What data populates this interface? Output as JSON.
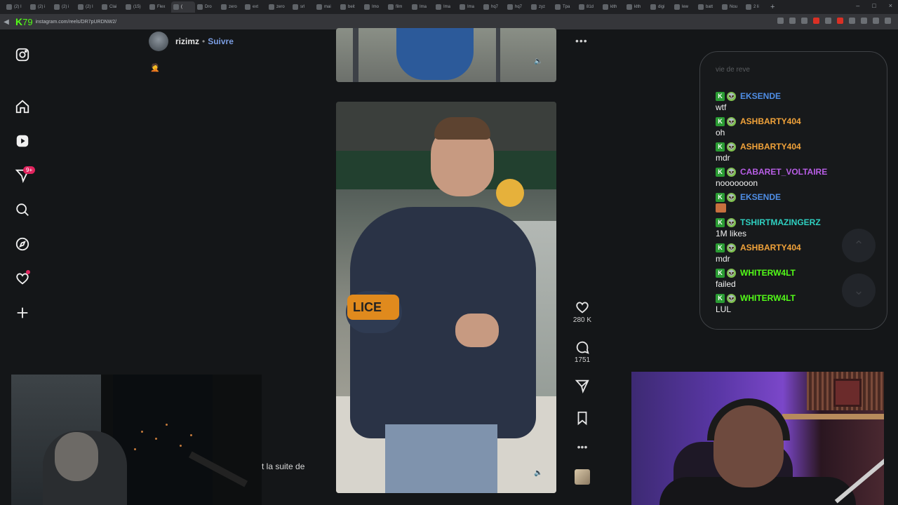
{
  "browser": {
    "tabs": [
      "(2) I",
      "(2) i",
      "(2) i",
      "(2) I",
      "Clai",
      "(15)",
      "Flex",
      "(",
      "Dro",
      "zero",
      "ext",
      "zero",
      "srl",
      "mai",
      "beit",
      "Imo",
      "film",
      "Ima",
      "Ima",
      "Ima",
      "hq7",
      "hq7",
      "zyz",
      "Tpa",
      "81d",
      "klth",
      "klth",
      "digi",
      "lew",
      "batt",
      "Nou",
      "2 li"
    ],
    "active_tab_index": 7,
    "url": "instagram.com/reels/DR7pURDNW2/",
    "kick_logo": "K",
    "kick_number": "79",
    "window_controls": [
      "–",
      "□",
      "×"
    ]
  },
  "sidebar": {
    "icons": [
      "instagram-logo-icon",
      "home-icon",
      "reels-icon",
      "messages-icon",
      "search-icon",
      "explore-icon",
      "notifications-icon",
      "create-icon"
    ],
    "messages_badge": "9+"
  },
  "post": {
    "author": "rizimz",
    "separator": "•",
    "follow_label": "Suivre",
    "caption_emoji": "🤦",
    "caption_tail": "t la suite de",
    "video_text": "LICE",
    "actions": {
      "likes": "280 K",
      "comments": "1751"
    },
    "more_label": "•••"
  },
  "chat": {
    "faded_text": "vie de reve",
    "messages": [
      {
        "user": "EKSENDE",
        "color": "#4f8ee6",
        "text": "wtf"
      },
      {
        "user": "ASHBARTY404",
        "color": "#f2a33a",
        "text": "oh"
      },
      {
        "user": "ASHBARTY404",
        "color": "#f2a33a",
        "text": "mdr"
      },
      {
        "user": "CABARET_VOLTAIRE",
        "color": "#b85ee6",
        "text": "nooooooon"
      },
      {
        "user": "EKSENDE",
        "color": "#4f8ee6",
        "text": ""
      },
      {
        "user": "TSHIRTMAZINGERZ",
        "color": "#2fd0c1",
        "text": "1M likes"
      },
      {
        "user": "ASHBARTY404",
        "color": "#f2a33a",
        "text": "mdr"
      },
      {
        "user": "WHITERW4LT",
        "color": "#53fc18",
        "text": "failed"
      },
      {
        "user": "WHITERW4LT",
        "color": "#53fc18",
        "text": "LUL"
      }
    ],
    "badge_k": "K",
    "badge_alien": "👽"
  },
  "colors": {
    "page_bg": "#141618",
    "follow": "#7a9ce0",
    "kick_green": "#53fc18",
    "notif_red": "#e0245e"
  }
}
